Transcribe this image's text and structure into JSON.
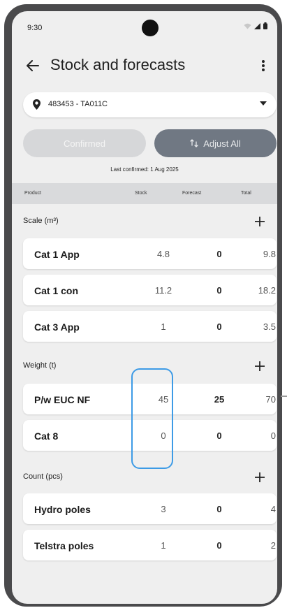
{
  "status_bar": {
    "time": "9:30"
  },
  "app_bar": {
    "title": "Stock and forecasts"
  },
  "location": {
    "selected": "483453 - TA011C"
  },
  "actions": {
    "confirmed_label": "Confirmed",
    "adjust_label": "Adjust All"
  },
  "last_confirmed": "Last confirmed: 1 Aug 2025",
  "table": {
    "headers": [
      "Product",
      "Stock",
      "Forecast",
      "Total"
    ]
  },
  "sections": [
    {
      "label": "Scale (m³)",
      "rows": [
        {
          "product": "Cat 1 App",
          "stock": "4.8",
          "forecast": "0",
          "total": "9.8"
        },
        {
          "product": "Cat 1 con",
          "stock": "11.2",
          "forecast": "0",
          "total": "18.2"
        },
        {
          "product": "Cat 3 App",
          "stock": "1",
          "forecast": "0",
          "total": "3.5"
        }
      ]
    },
    {
      "label": "Weight (t)",
      "rows": [
        {
          "product": "P/w EUC NF",
          "stock": "45",
          "forecast": "25",
          "total": "70"
        },
        {
          "product": "Cat 8",
          "stock": "0",
          "forecast": "0",
          "total": "0"
        }
      ]
    },
    {
      "label": "Count (pcs)",
      "rows": [
        {
          "product": "Hydro poles",
          "stock": "3",
          "forecast": "0",
          "total": "4"
        },
        {
          "product": "Telstra poles",
          "stock": "1",
          "forecast": "0",
          "total": "2"
        }
      ]
    }
  ],
  "colors": {
    "highlight": "#3d9be6",
    "primary_button": "#707883",
    "disabled_button": "#d6d7d9"
  },
  "icons": [
    "arrow-back-icon",
    "more-vert-icon",
    "location-pin-icon",
    "dropdown-caret-icon",
    "adjust-icon",
    "add-icon",
    "wifi-icon",
    "signal-icon",
    "battery-icon"
  ]
}
